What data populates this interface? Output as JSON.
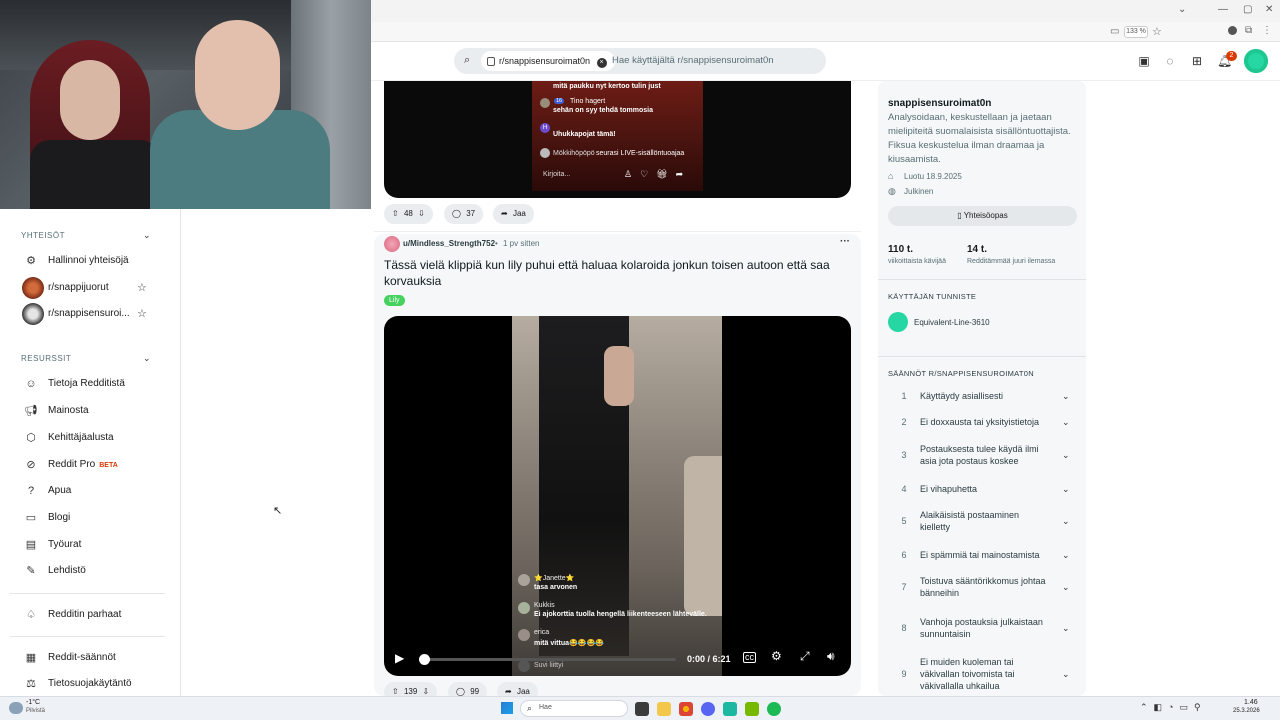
{
  "browser": {
    "zoom": "133 %",
    "window_controls": [
      "—",
      "▢",
      "✕"
    ]
  },
  "header": {
    "chip_label": "r/snappisensuroimat0n",
    "search_placeholder": "Hae käyttäjältä r/snappisensuroimat0n",
    "notification_count": "2"
  },
  "sidebar": {
    "communities_heading": "YHTEISÖT",
    "communities": [
      {
        "label": "Hallinnoi yhteisöjä"
      },
      {
        "label": "r/snappijuorut"
      },
      {
        "label": "r/snappisensuroi..."
      }
    ],
    "resources_heading": "RESURSSIT",
    "resources": [
      {
        "label": "Tietoja Redditistä"
      },
      {
        "label": "Mainosta"
      },
      {
        "label": "Kehittäjäalusta"
      },
      {
        "label": "Reddit Pro",
        "badge": "BETA"
      },
      {
        "label": "Apua"
      },
      {
        "label": "Blogi"
      },
      {
        "label": "Työurat"
      },
      {
        "label": "Lehdistö"
      }
    ],
    "best_of": "Redditin parhaat",
    "legal": [
      {
        "label": "Reddit-säännöt"
      },
      {
        "label": "Tietosuojakäytäntö"
      }
    ]
  },
  "post1": {
    "comments": [
      {
        "user": "",
        "text": "mitä paukku nyt kertoo tulin just"
      },
      {
        "user": "Tino hagert",
        "text": "sehän on syy tehdä tommosia"
      },
      {
        "user": "",
        "text": "Uhukkapojat tämä!"
      },
      {
        "user": "Mökkihöpöpö",
        "text": "seurasi LIVE-sisällöntuoajaa"
      }
    ],
    "live_badge": "16",
    "input_placeholder": "Kirjoita...",
    "upvotes": "48",
    "comments_count": "37",
    "share": "Jaa"
  },
  "post2": {
    "author": "u/Mindless_Strength752",
    "time": "1 pv sitten",
    "title": "Tässä vielä klippiä kun lily puhui että haluaa kolaroida jonkun toisen autoon että saa korvauksia",
    "flair": "Lily",
    "video_comments": [
      {
        "user": "⭐Janette⭐",
        "text": "tasa arvonen"
      },
      {
        "user": "Kukkis",
        "text": "Ei ajokorttia tuolla hengellä liikenteeseen lähtevälle."
      },
      {
        "user": "erica",
        "text": "mitä vittua😂😂😂😂"
      },
      {
        "user": "",
        "text": "Suvi liittyi"
      }
    ],
    "time_display": "0:00 / 6:21",
    "progress": 0.0,
    "upvotes": "139",
    "comments_count": "99",
    "share": "Jaa"
  },
  "community": {
    "name": "snappisensuroimat0n",
    "description": "Analysoidaan, keskustellaan ja jaetaan mielipiteitä suomalaisista sisällöntuottajista. Fiksua keskustelua ilman draamaa ja kiusaamista.",
    "created": "Luotu 18.9.2025",
    "visibility": "Julkinen",
    "guide_button": "Yhteisöopas",
    "stat1_value": "110 t.",
    "stat1_label": "viikoittaista kävijää",
    "stat2_value": "14 t.",
    "stat2_label": "Redditämmää juuri ilemassa",
    "flair_heading": "KÄYTTÄJÄN TUNNISTE",
    "flair_user": "Equivalent-Line-3610",
    "rules_heading": "SÄÄNNÖT R/SNAPPISENSUROIMAT0N",
    "rules": [
      {
        "n": "1",
        "text": "Käyttäydy asiallisesti"
      },
      {
        "n": "2",
        "text": "Ei doxxausta tai yksityistietoja"
      },
      {
        "n": "3",
        "text": "Postauksesta tulee käydä ilmi asia jota postaus koskee"
      },
      {
        "n": "4",
        "text": "Ei vihapuhetta"
      },
      {
        "n": "5",
        "text": "Alaikäisistä postaaminen kielletty"
      },
      {
        "n": "6",
        "text": "Ei spämmiä tai mainostamista"
      },
      {
        "n": "7",
        "text": "Toistuva sääntörikkomus johtaa bänneihin"
      },
      {
        "n": "8",
        "text": "Vanhoja postauksia julkaistaan sunnuntaisin"
      },
      {
        "n": "9",
        "text": "Ei muiden kuoleman tai väkivallan toivomista tai väkivallalla uhkailua"
      }
    ]
  },
  "taskbar": {
    "weather_temp": "-1°C",
    "weather_label": "Pilvistä",
    "search_placeholder": "Hae",
    "clock_time": "1.46",
    "clock_date": "25.3.2026"
  }
}
